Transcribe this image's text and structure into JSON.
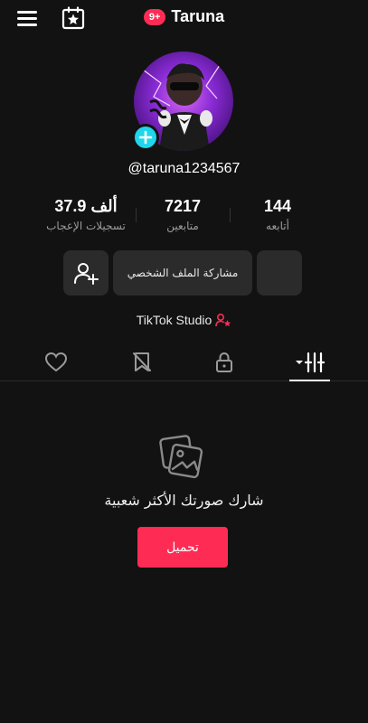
{
  "header": {
    "title": "Taruna",
    "notification_badge": "9+",
    "menu_icon": "hamburger-menu-icon",
    "calendar_icon": "calendar-star-icon"
  },
  "profile": {
    "username": "@taruna1234567",
    "avatar_icon": "avatar",
    "add_icon": "plus-icon"
  },
  "stats": {
    "following": {
      "count": "144",
      "label": "أتابعه"
    },
    "followers": {
      "count": "7217",
      "label": "متابعين"
    },
    "likes": {
      "count": "37.9 ألف",
      "label": "تسجيلات الإعجاب"
    }
  },
  "actions": {
    "share_profile": "مشاركة الملف الشخصي"
  },
  "studio": {
    "label": "TikTok Studio"
  },
  "tabs": [
    {
      "icon": "grid-filter-icon",
      "active": true
    },
    {
      "icon": "lock-icon",
      "active": false
    },
    {
      "icon": "bookmark-hidden-icon",
      "active": false
    },
    {
      "icon": "heart-icon",
      "active": false
    }
  ],
  "empty_state": {
    "message": "شارك صورتك الأكثر شعبية",
    "upload_label": "تحميل"
  },
  "colors": {
    "accent": "#fe2c55",
    "cyan": "#20d5ec",
    "background": "#121212",
    "button": "#2b2b2b"
  }
}
